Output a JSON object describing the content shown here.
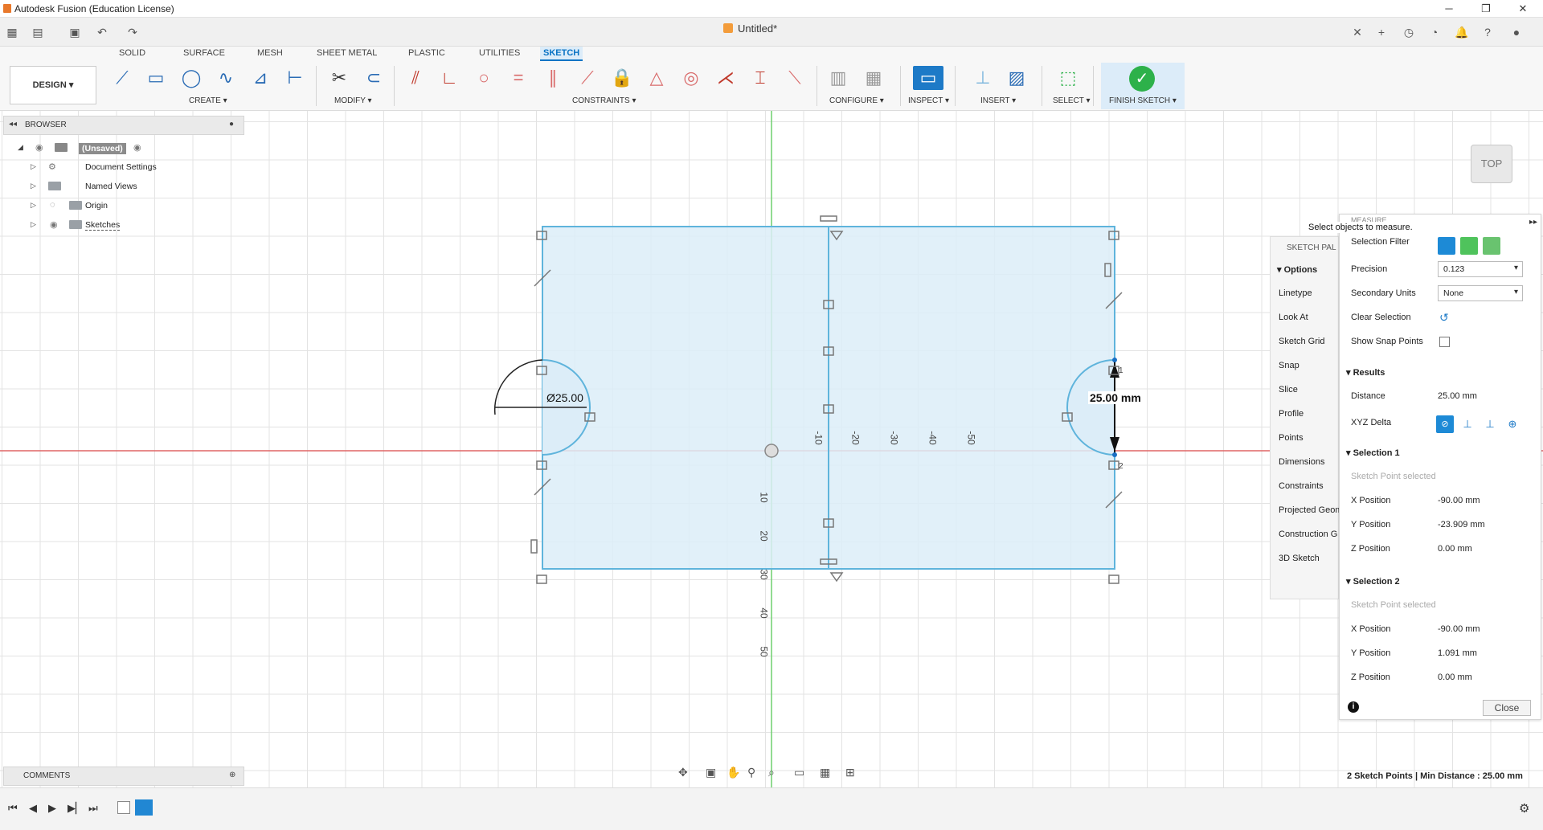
{
  "window": {
    "title": "Autodesk Fusion (Education License)",
    "document_tab": "Untitled*",
    "controls": [
      "─",
      "❐",
      "✕"
    ]
  },
  "ribbon": {
    "workspace": "DESIGN ▾",
    "tabs": [
      "SOLID",
      "SURFACE",
      "MESH",
      "SHEET METAL",
      "PLASTIC",
      "UTILITIES",
      "SKETCH"
    ],
    "active_tab": "SKETCH",
    "groups": {
      "create": "CREATE ▾",
      "modify": "MODIFY ▾",
      "constraints": "CONSTRAINTS ▾",
      "configure": "CONFIGURE ▾",
      "inspect": "INSPECT ▾",
      "insert": "INSERT ▾",
      "select": "SELECT ▾",
      "finish": "FINISH SKETCH ▾"
    }
  },
  "browser": {
    "header": "BROWSER",
    "items": [
      {
        "label": "(Unsaved)"
      },
      {
        "label": "Document Settings"
      },
      {
        "label": "Named Views"
      },
      {
        "label": "Origin"
      },
      {
        "label": "Sketches"
      }
    ]
  },
  "comments": {
    "header": "COMMENTS"
  },
  "canvas": {
    "axis_ticks_h": [
      "-10",
      "-20",
      "-30",
      "-40",
      "-50"
    ],
    "axis_ticks_v": [
      "10",
      "20",
      "30",
      "40",
      "50"
    ],
    "diameter_dim": "Ø25.00",
    "distance_dim": "25.00 mm",
    "point_labels": [
      "1",
      "2"
    ],
    "viewcube_label": "TOP"
  },
  "sketch_palette": {
    "header": "SKETCH PAL",
    "section": "Options",
    "items": [
      "Linetype",
      "Look At",
      "Sketch Grid",
      "Snap",
      "Slice",
      "Profile",
      "Points",
      "Dimensions",
      "Constraints",
      "Projected Geom",
      "Construction G",
      "3D Sketch"
    ]
  },
  "measure": {
    "header": "MEASURE",
    "tooltip": "Select objects to measure.",
    "selection_filter_label": "Selection Filter",
    "precision_label": "Precision",
    "precision_value": "0.123",
    "secondary_units_label": "Secondary Units",
    "secondary_units_value": "None",
    "clear_selection_label": "Clear Selection",
    "show_snap_points_label": "Show Snap Points",
    "results_header": "Results",
    "distance_label": "Distance",
    "distance_value": "25.00 mm",
    "xyz_delta_label": "XYZ Delta",
    "selection1": {
      "header": "Selection 1",
      "subtitle": "Sketch Point selected",
      "x_label": "X Position",
      "x": "-90.00 mm",
      "y_label": "Y Position",
      "y": "-23.909 mm",
      "z_label": "Z Position",
      "z": "0.00 mm"
    },
    "selection2": {
      "header": "Selection 2",
      "subtitle": "Sketch Point selected",
      "x_label": "X Position",
      "x": "-90.00 mm",
      "y_label": "Y Position",
      "y": "1.091 mm",
      "z_label": "Z Position",
      "z": "0.00 mm"
    },
    "close_label": "Close"
  },
  "status": {
    "text": "2 Sketch Points | Min Distance : 25.00 mm"
  },
  "colors": {
    "accent": "#0a73c4",
    "sketch_fill": "#dcedf8",
    "sketch_stroke": "#5fb4dc",
    "x_axis": "#e06666",
    "y_axis": "#6fcf6f",
    "finish_green": "#2db14a"
  }
}
